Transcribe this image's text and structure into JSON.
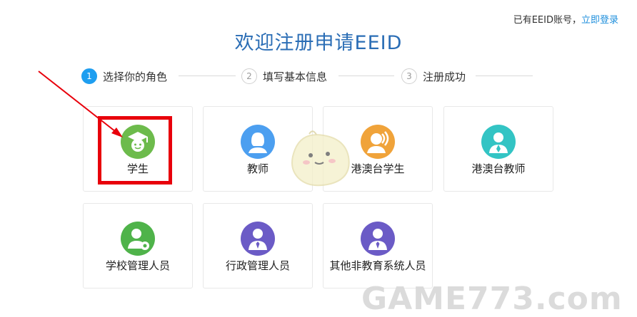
{
  "header": {
    "login_hint": "已有EEID账号，",
    "login_link": "立即登录",
    "title": "欢迎注册申请EEID"
  },
  "steps": [
    {
      "num": "1",
      "label": "选择你的角色",
      "active": true
    },
    {
      "num": "2",
      "label": "填写基本信息",
      "active": false
    },
    {
      "num": "3",
      "label": "注册成功",
      "active": false
    }
  ],
  "roles": [
    {
      "label": "学生",
      "icon": "student-graduation-cap-icon",
      "color": "#6dbb4c"
    },
    {
      "label": "教师",
      "icon": "teacher-person-icon",
      "color": "#4c9ff0"
    },
    {
      "label": "港澳台学生",
      "icon": "hmt-student-icon",
      "color": "#f0a33a"
    },
    {
      "label": "港澳台教师",
      "icon": "hmt-teacher-icon",
      "color": "#33c4c4"
    },
    {
      "label": "学校管理人员",
      "icon": "school-admin-gear-icon",
      "color": "#4fb34a"
    },
    {
      "label": "行政管理人员",
      "icon": "admin-staff-tie-icon",
      "color": "#6b5bc6"
    },
    {
      "label": "其他非教育系统人员",
      "icon": "other-staff-tie-icon",
      "color": "#6b5bc6"
    }
  ],
  "watermark": "GAME773.com"
}
